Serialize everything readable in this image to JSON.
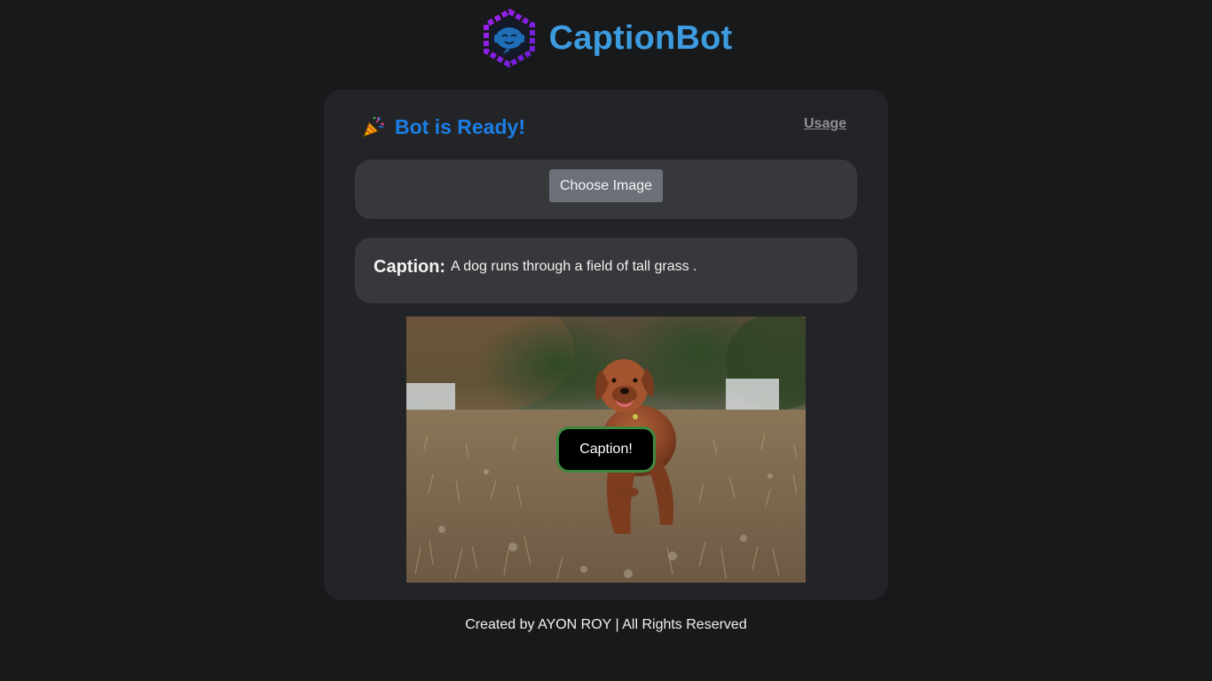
{
  "app": {
    "title": "CaptionBot",
    "brand_color": "#3d9be0",
    "logo_icon": "robot-hexagon-icon"
  },
  "status": {
    "icon": "party-popper-icon",
    "text": "Bot is Ready!",
    "color": "#1b7ee6"
  },
  "nav": {
    "usage_label": "Usage"
  },
  "upload": {
    "choose_label": "Choose Image"
  },
  "caption": {
    "label": "Caption:",
    "text": "A dog runs through a field of tall grass ."
  },
  "image": {
    "subject": "dog-running-in-field-photo",
    "button_label": "Caption!",
    "button_border_color": "#3d8a3e"
  },
  "footer": {
    "text": "Created by AYON ROY | All Rights Reserved"
  }
}
